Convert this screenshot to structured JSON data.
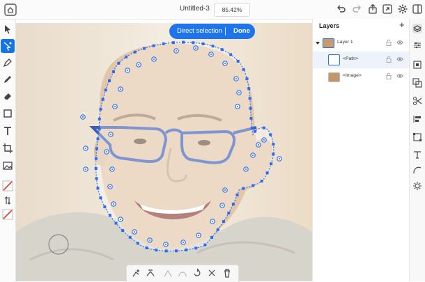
{
  "header": {
    "doc_title": "Untitled-3",
    "zoom": "85.42%"
  },
  "selection_bar": {
    "mode_label": "Direct selection",
    "done_label": "Done"
  },
  "layers_panel": {
    "title": "Layers",
    "add_label": "+",
    "rows": [
      {
        "label": "Layer 1"
      },
      {
        "label": "<Path>"
      },
      {
        "label": "<Image>"
      }
    ]
  },
  "toolbar_icons": [
    "home-icon",
    "undo-icon",
    "redo-icon",
    "share-icon",
    "export-icon",
    "settings-icon",
    "layout-icon"
  ],
  "colors": {
    "accent": "#1e74e8",
    "path": "#2d6cf0",
    "stroke_swatch": "#e53935"
  }
}
